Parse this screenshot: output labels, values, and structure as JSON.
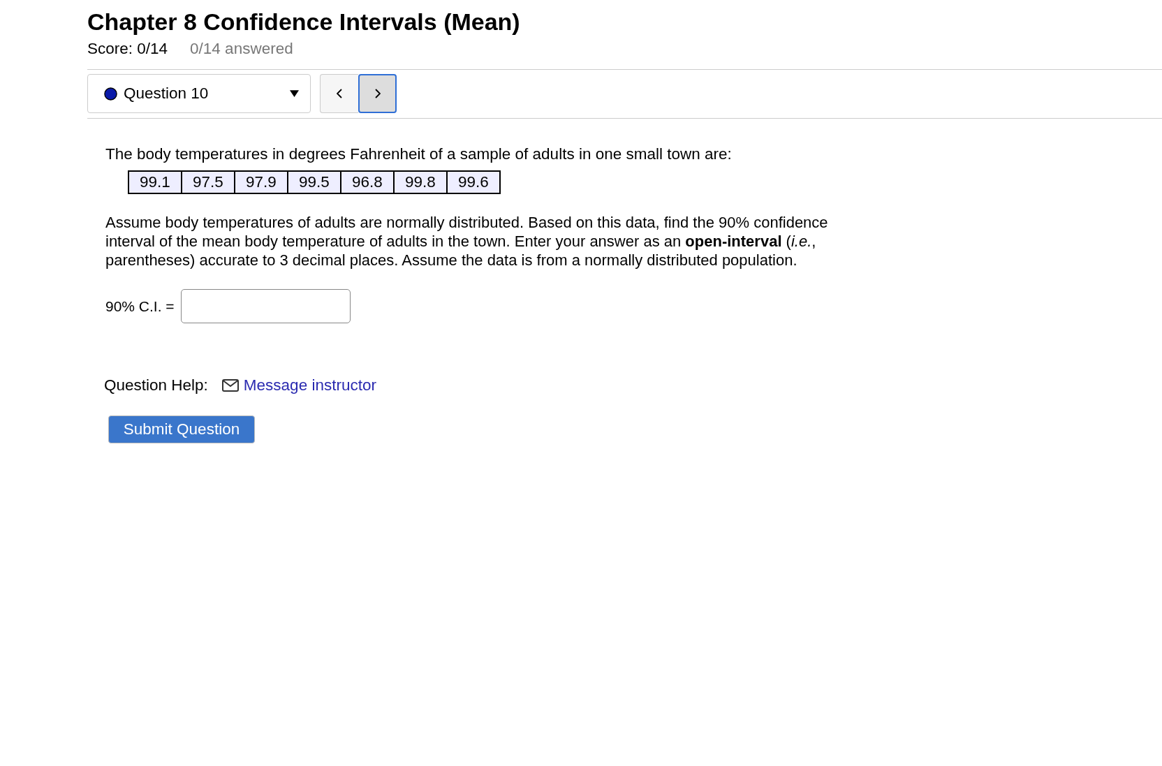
{
  "header": {
    "title": "Chapter 8 Confidence Intervals (Mean)",
    "score": "Score: 0/14",
    "answered": "0/14 answered"
  },
  "navigation": {
    "question": "Question 10",
    "buttons": [
      {
        "kind": "previous",
        "focused": false
      },
      {
        "kind": "next",
        "focused": true
      }
    ]
  },
  "question": {
    "intro": "The body temperatures in degrees Fahrenheit of a sample of adults in one small town are:",
    "data": [
      "99.1",
      "97.5",
      "97.9",
      "99.5",
      "96.8",
      "99.8",
      "99.6"
    ],
    "text": "Assume body temperatures of adults are normally distributed. Based on this data, find the 90% confidence interval of the mean body temperature of adults in the town. Enter your answer as an **open-interval** (*i.e.*, parentheses) accurate to 3 decimal places. Assume the data is from a normally distributed population.",
    "answer_label": "90% C.I. ="
  },
  "help": {
    "label": "Question Help:",
    "link": "Message instructor"
  },
  "submit_button": "Submit Question"
}
